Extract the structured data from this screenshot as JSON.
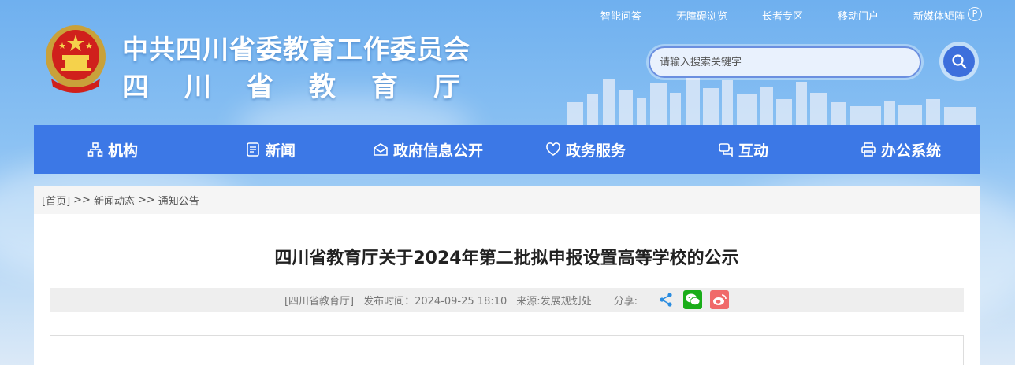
{
  "top_links": [
    "智能问答",
    "无障碍浏览",
    "长者专区",
    "移动门户",
    "新媒体矩阵"
  ],
  "header": {
    "title": "中共四川省委教育工作委员会",
    "subtitle": "四川省教育厅"
  },
  "search": {
    "placeholder": "请输入搜索关键字"
  },
  "nav": [
    {
      "label": "机构",
      "icon": "org-icon"
    },
    {
      "label": "新闻",
      "icon": "news-icon"
    },
    {
      "label": "政府信息公开",
      "icon": "info-open-icon"
    },
    {
      "label": "政务服务",
      "icon": "service-icon"
    },
    {
      "label": "互动",
      "icon": "interact-icon"
    },
    {
      "label": "办公系统",
      "icon": "printer-icon"
    }
  ],
  "breadcrumb": {
    "home": "[首页]",
    "sep": ">>",
    "level1": "新闻动态",
    "level2": "通知公告"
  },
  "article": {
    "title": "四川省教育厅关于2024年第二批拟申报设置高等学校的公示",
    "meta_org": "[四川省教育厅]",
    "meta_time": "发布时间：2024-09-25 18:10",
    "meta_source": "来源:发展规划处",
    "meta_share": "分享:"
  },
  "colors": {
    "nav_bg": "#3c78e6",
    "wechat": "#1aad19",
    "weibo": "#e6162d",
    "share": "#2a8ce0"
  }
}
